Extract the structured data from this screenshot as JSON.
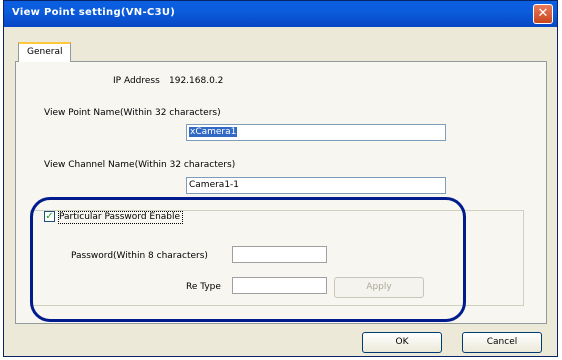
{
  "window": {
    "title": "View Point setting(VN-C3U)"
  },
  "tabs": [
    {
      "label": "General"
    }
  ],
  "general": {
    "ip_label": "IP Address",
    "ip_value": "192.168.0.2",
    "view_point_label": "View Point Name(Within 32 characters)",
    "view_point_value": "xCamera1",
    "view_channel_label": "View Channel Name(Within 32 characters)",
    "view_channel_value": "Camera1-1"
  },
  "password_group": {
    "checkbox_label": "Particular Password Enable",
    "checked": true,
    "password_label": "Password(Within 8 characters)",
    "password_value": "",
    "retype_label": "Re Type",
    "retype_value": "",
    "apply_label": "Apply"
  },
  "footer": {
    "ok_label": "OK",
    "cancel_label": "Cancel"
  },
  "colors": {
    "titlebar": "#0a5ee0",
    "highlight_outline": "#001c8c",
    "close_button": "#d9532d"
  }
}
